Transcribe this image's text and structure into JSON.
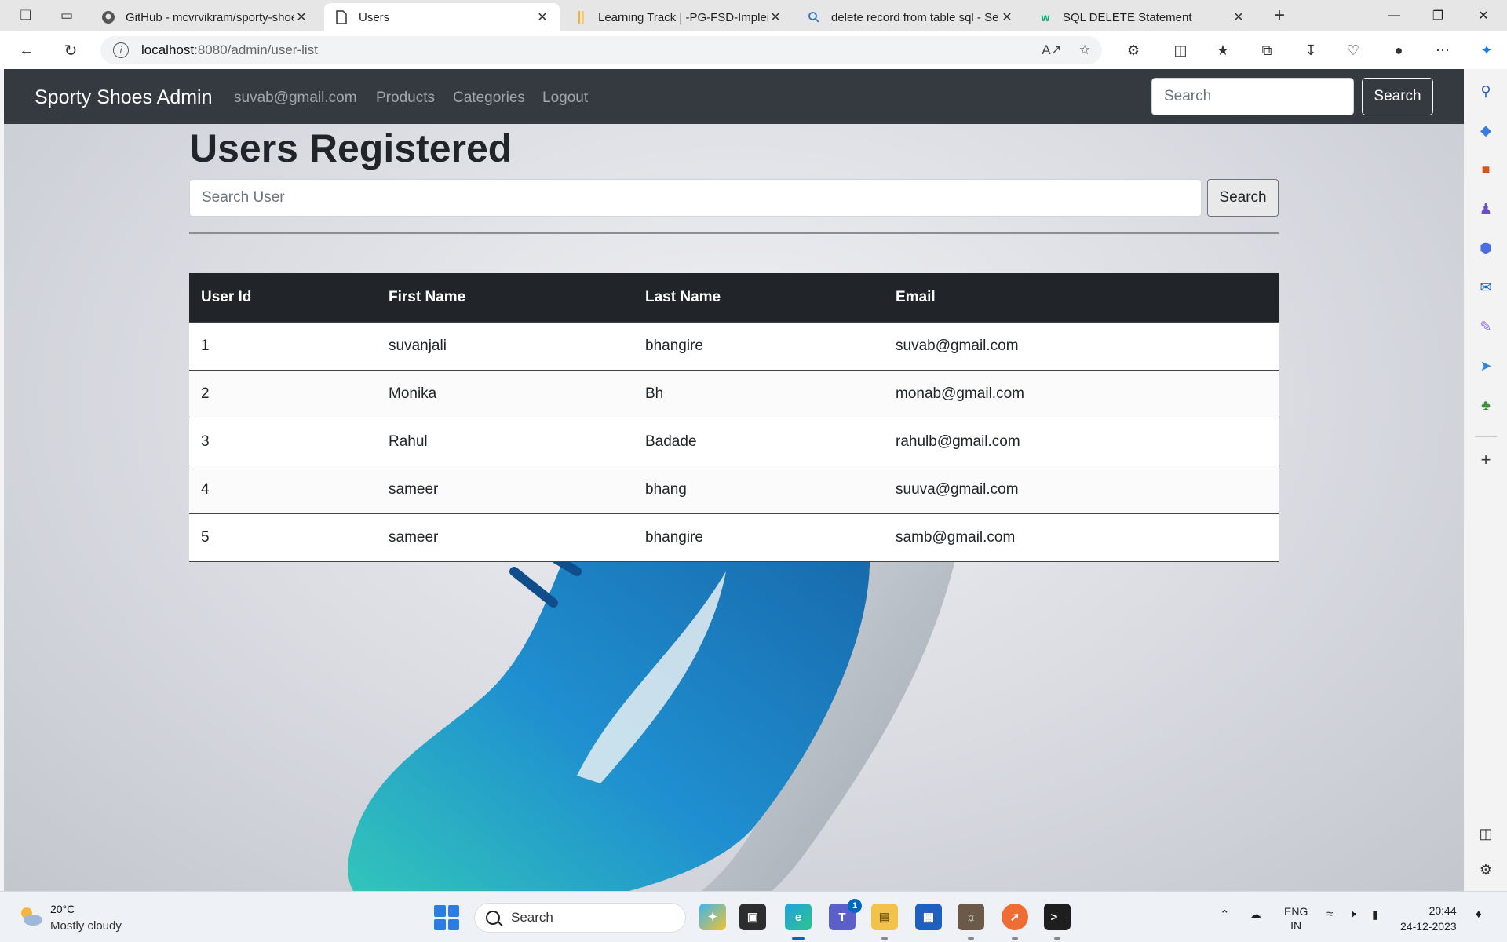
{
  "browser": {
    "tabs": [
      {
        "title": "GitHub - mcvrvikram/sporty-shoes",
        "icon": "github-icon",
        "active": false
      },
      {
        "title": "Users",
        "icon": "page-icon",
        "active": true
      },
      {
        "title": "Learning Track | -PG-FSD-Implementation",
        "icon": "learning-track-icon",
        "active": false
      },
      {
        "title": "delete record from table sql - Search",
        "icon": "search-icon",
        "active": false
      },
      {
        "title": "SQL DELETE Statement",
        "icon": "w3schools-icon",
        "active": false
      }
    ],
    "url_host": "localhost",
    "url_path": ":8080/admin/user-list"
  },
  "navbar": {
    "brand": "Sporty Shoes Admin",
    "links": [
      "suvab@gmail.com",
      "Products",
      "Categories",
      "Logout"
    ],
    "search_placeholder": "Search",
    "search_button": "Search"
  },
  "main": {
    "title": "Users Registered",
    "search_placeholder": "Search User",
    "search_button": "Search"
  },
  "table": {
    "headers": [
      "User Id",
      "First Name",
      "Last Name",
      "Email"
    ],
    "rows": [
      [
        "1",
        "suvanjali",
        "bhangire",
        "suvab@gmail.com"
      ],
      [
        "2",
        "Monika",
        "Bh",
        "monab@gmail.com"
      ],
      [
        "3",
        "Rahul",
        "Badade",
        "rahulb@gmail.com"
      ],
      [
        "4",
        "sameer",
        "bhang",
        "suuva@gmail.com"
      ],
      [
        "5",
        "sameer",
        "bhangire",
        "samb@gmail.com"
      ]
    ]
  },
  "taskbar": {
    "weather_temp": "20°C",
    "weather_desc": "Mostly cloudy",
    "search_label": "Search",
    "teams_badge": "1",
    "lang_line1": "ENG",
    "lang_line2": "IN",
    "time": "20:44",
    "date": "24-12-2023"
  },
  "colors": {
    "navbar_bg": "#343a40",
    "table_header_bg": "#212529",
    "accent": "#0067c0"
  }
}
